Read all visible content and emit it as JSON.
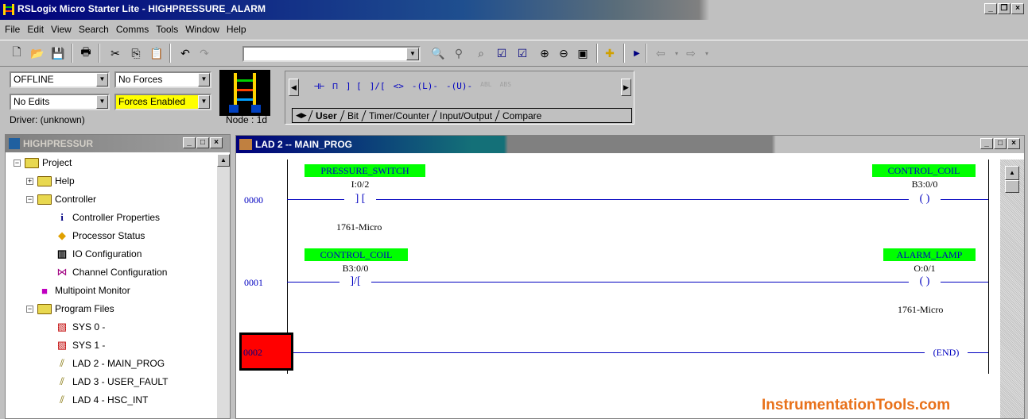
{
  "window": {
    "title": "RSLogix Micro Starter Lite - HIGHPRESSURE_ALARM"
  },
  "menu": [
    "File",
    "Edit",
    "View",
    "Search",
    "Comms",
    "Tools",
    "Window",
    "Help"
  ],
  "status": {
    "mode": "OFFLINE",
    "forces": "No Forces",
    "edits": "No Edits",
    "forces_enabled": "Forces Enabled",
    "driver": "Driver: (unknown)",
    "node": "Node : 1d"
  },
  "instruction_palette": {
    "tabs": [
      "User",
      "Bit",
      "Timer/Counter",
      "Input/Output",
      "Compare"
    ],
    "active_tab": "User",
    "icons": [
      "rung-icon",
      "branch-icon",
      "xic-icon",
      "xio-icon",
      "ote-icon",
      "otl-icon",
      "otu-icon"
    ],
    "dim_labels": [
      "ABL",
      "ABS"
    ]
  },
  "project": {
    "title": "HIGHPRESSUR",
    "tree": [
      {
        "label": "Project",
        "icon": "folder-icon"
      },
      {
        "label": "Help",
        "icon": "folder-icon"
      },
      {
        "label": "Controller",
        "icon": "folder-icon"
      },
      {
        "label": "Controller Properties",
        "icon": "info-icon"
      },
      {
        "label": "Processor Status",
        "icon": "status-icon"
      },
      {
        "label": "IO Configuration",
        "icon": "io-icon"
      },
      {
        "label": "Channel Configuration",
        "icon": "channel-icon"
      },
      {
        "label": "Multipoint Monitor",
        "icon": "monitor-icon"
      },
      {
        "label": "Program Files",
        "icon": "folder-icon"
      },
      {
        "label": "SYS 0 -",
        "icon": "sys-file-icon"
      },
      {
        "label": "SYS 1 -",
        "icon": "sys-file-icon"
      },
      {
        "label": "LAD 2 - MAIN_PROG",
        "icon": "ladder-file-icon"
      },
      {
        "label": "LAD 3 - USER_FAULT",
        "icon": "ladder-file-icon"
      },
      {
        "label": "LAD 4 - HSC_INT",
        "icon": "ladder-file-icon"
      }
    ]
  },
  "ladder": {
    "title": "LAD 2 -- MAIN_PROG",
    "rungs": [
      {
        "number": "0000",
        "input_tag": "PRESSURE_SWITCH",
        "input_addr": "I:0/2",
        "input_type": "XIC",
        "input_desc": "1761-Micro",
        "output_tag": "CONTROL_COIL",
        "output_addr": "B3:0/0"
      },
      {
        "number": "0001",
        "input_tag": "CONTROL_COIL",
        "input_addr": "B3:0/0",
        "input_type": "XIO",
        "output_tag": "ALARM_LAMP",
        "output_addr": "O:0/1",
        "output_desc": "1761-Micro"
      },
      {
        "number": "0002",
        "output_label": "END"
      }
    ]
  },
  "watermark": "InstrumentationTools.com"
}
